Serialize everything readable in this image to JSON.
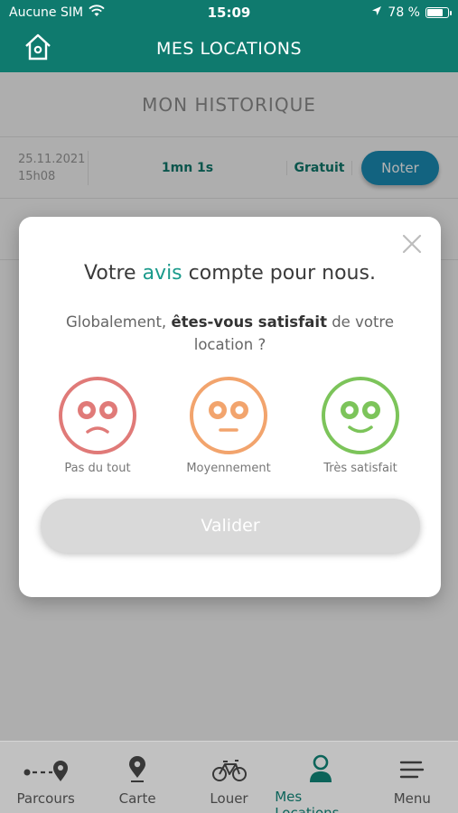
{
  "status_bar": {
    "carrier": "Aucune SIM",
    "time": "15:09",
    "battery": "78 %",
    "battery_level": 0.78
  },
  "header": {
    "title": "MES LOCATIONS",
    "home_icon": "home-icon"
  },
  "history": {
    "title": "MON HISTORIQUE",
    "rows": [
      {
        "date": "25.11.2021",
        "time": "15h08",
        "duration": "1mn 1s",
        "price": "Gratuit",
        "action": "Noter"
      }
    ]
  },
  "modal": {
    "title_prefix": "Votre ",
    "title_accent": "avis",
    "title_suffix": " compte pour nous.",
    "question_part1": "Globalement, ",
    "question_bold": "êtes-vous satisfait",
    "question_part2": " de votre location ?",
    "options": [
      {
        "label": "Pas du tout",
        "icon": "sad-face-icon",
        "color": "#e07a78"
      },
      {
        "label": "Moyennement",
        "icon": "neutral-face-icon",
        "color": "#f2a46d"
      },
      {
        "label": "Très satisfait",
        "icon": "happy-face-icon",
        "color": "#7cc45a"
      }
    ],
    "submit_label": "Valider"
  },
  "tabs": [
    {
      "label": "Parcours",
      "icon": "route-icon",
      "active": false
    },
    {
      "label": "Carte",
      "icon": "map-pin-icon",
      "active": false
    },
    {
      "label": "Louer",
      "icon": "bike-icon",
      "active": false
    },
    {
      "label": "Mes Locations",
      "icon": "user-icon",
      "active": true
    },
    {
      "label": "Menu",
      "icon": "menu-icon",
      "active": false
    }
  ],
  "colors": {
    "brand": "#0f7a6e",
    "accent": "#1a9a8b",
    "button_blue": "#1a8fb8"
  }
}
